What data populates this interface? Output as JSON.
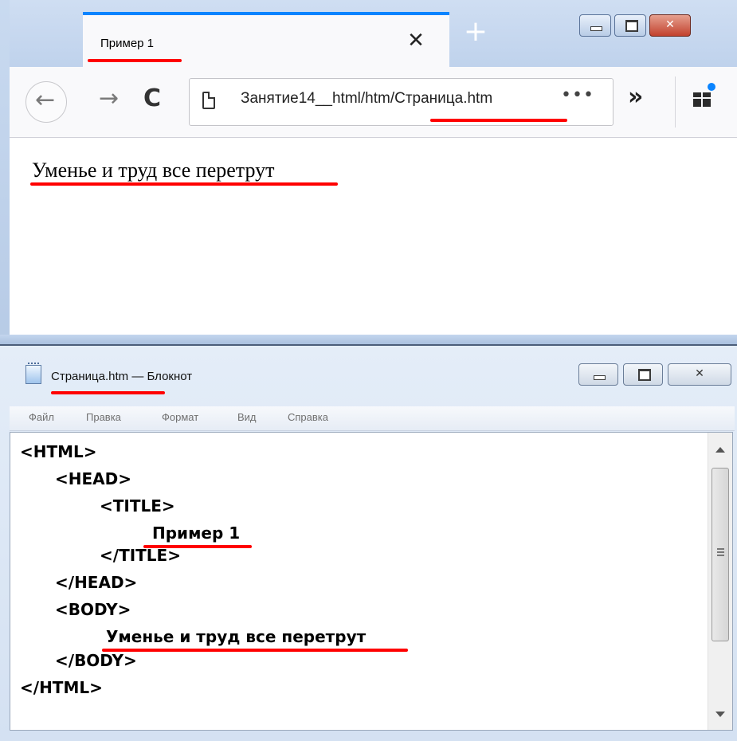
{
  "browser": {
    "tab_title": "Пример 1",
    "tab_close": "✕",
    "new_tab": "+",
    "back_glyph": "←",
    "forward_glyph": "→",
    "reload_glyph": "C",
    "url": "Занятие14__html/htm/Страница.htm",
    "url_more": "•••",
    "overflow": "»",
    "page_text": "Уменье и труд все перетрут",
    "colors": {
      "tab_accent": "#0a84ff",
      "close_button": "#c2412d",
      "highlight": "#ff0000"
    }
  },
  "notepad": {
    "title": "Страница.htm — Блокнот",
    "menu": [
      "Файл",
      "Правка",
      "Формат",
      "Вид",
      "Справка"
    ],
    "code_lines": [
      "<HTML>",
      "<HEAD>",
      "<TITLE>",
      "Пример 1",
      "</TITLE>",
      "</HEAD>",
      "<BODY>",
      "Уменье и труд все перетрут",
      "</BODY>",
      "</HTML>"
    ]
  }
}
